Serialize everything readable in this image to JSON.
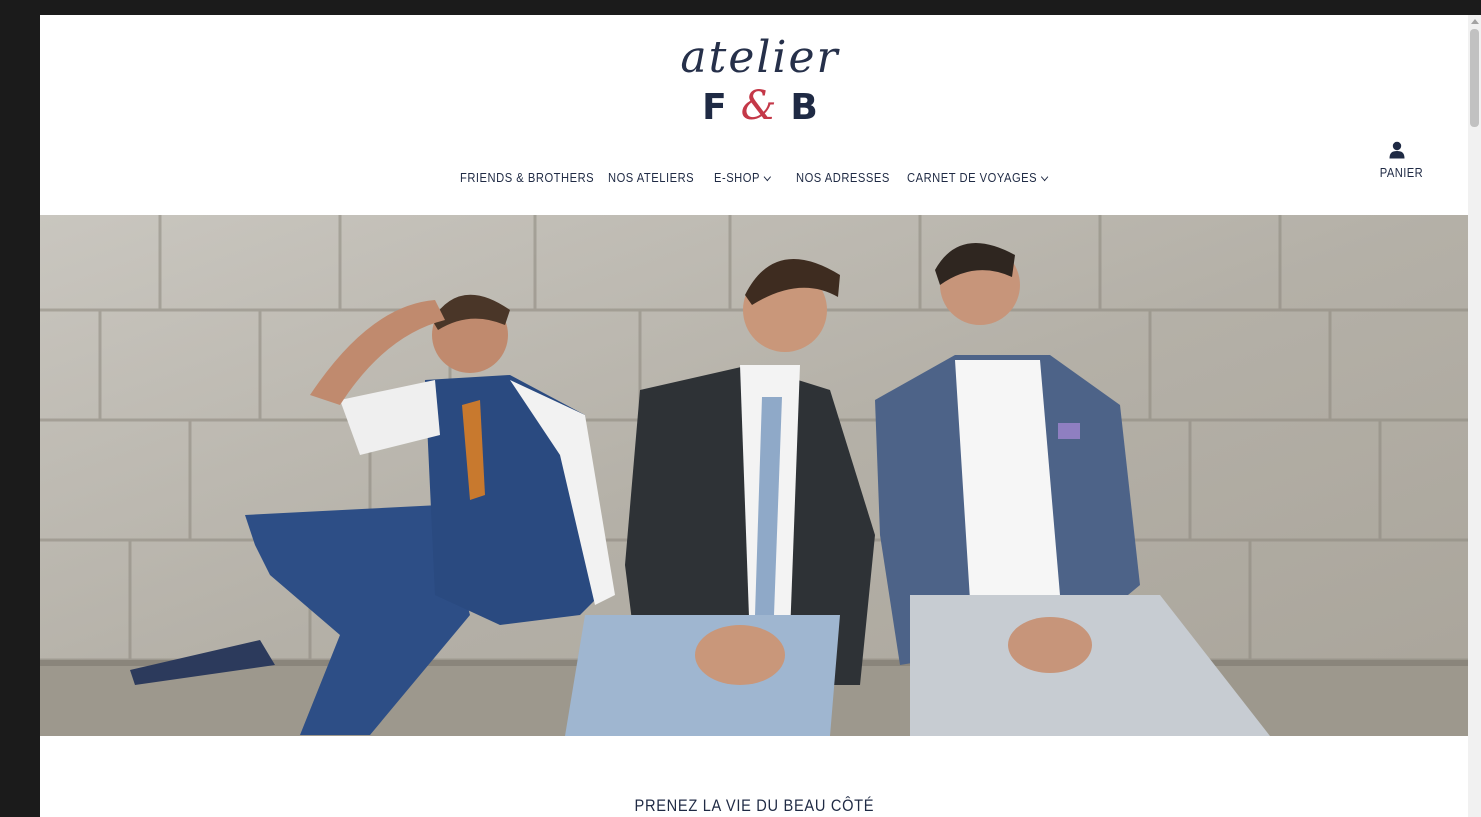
{
  "brand": {
    "script": "atelier",
    "letter_left": "F",
    "ampersand": "&",
    "letter_right": "B"
  },
  "nav": {
    "items": [
      {
        "label": "FRIENDS & BROTHERS",
        "has_dropdown": false
      },
      {
        "label": "NOS ATELIERS",
        "has_dropdown": false
      },
      {
        "label": "E-SHOP",
        "has_dropdown": true
      },
      {
        "label": "NOS ADRESSES",
        "has_dropdown": false
      },
      {
        "label": "CARNET DE VOYAGES",
        "has_dropdown": true
      }
    ]
  },
  "account": {
    "icon": "user-icon",
    "cart_label": "PANIER"
  },
  "hero": {
    "image": "three-men-in-suits-on-stone-wall"
  },
  "tagline": "PRENEZ LA VIE DU BEAU CÔTÉ",
  "colors": {
    "navy": "#1f2a44",
    "accent_red": "#c43848",
    "background": "#ffffff",
    "frame": "#1b1b1b"
  }
}
